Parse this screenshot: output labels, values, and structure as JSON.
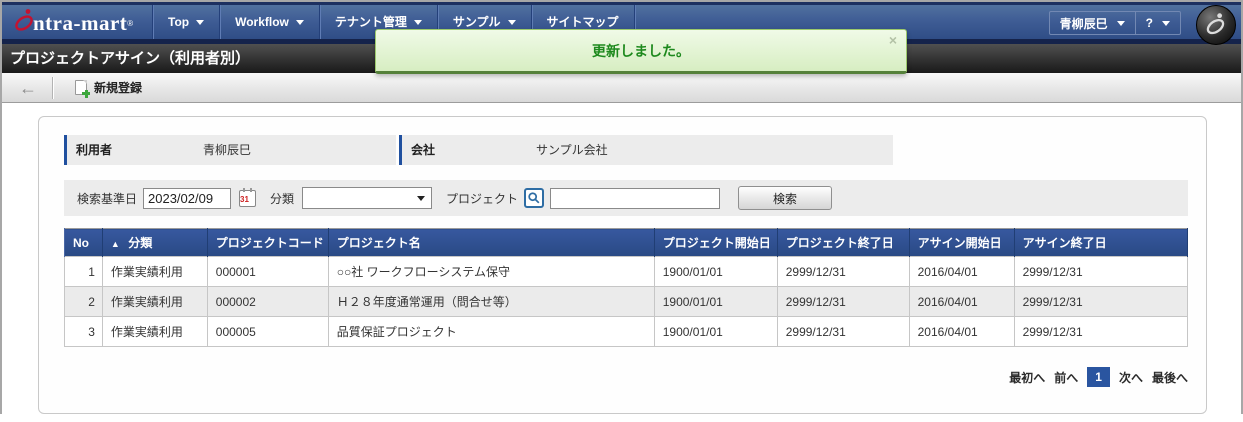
{
  "navbar": {
    "logo": {
      "text": "ntra-mart",
      "reg": "®"
    },
    "items": [
      {
        "label": "Top"
      },
      {
        "label": "Workflow"
      },
      {
        "label": "テナント管理"
      },
      {
        "label": "サンプル"
      },
      {
        "label": "サイトマップ"
      }
    ],
    "user_name": "青柳辰巳",
    "help_label": "?"
  },
  "icons": {
    "back": "←",
    "close": "×",
    "sort_asc": "▲"
  },
  "notification": {
    "message": "更新しました。"
  },
  "page_title": "プロジェクトアサイン（利用者別）",
  "toolbar": {
    "new_label": "新規登録"
  },
  "info": {
    "user_label": "利用者",
    "user_value": "青柳辰巳",
    "company_label": "会社",
    "company_value": "サンプル会社"
  },
  "search": {
    "base_date_label": "検索基準日",
    "base_date_value": "2023/02/09",
    "calendar_day": "31",
    "category_label": "分類",
    "category_value": "",
    "project_label": "プロジェクト",
    "project_value": "",
    "search_label": "検索"
  },
  "table": {
    "columns": [
      "No",
      "分類",
      "プロジェクトコード",
      "プロジェクト名",
      "プロジェクト開始日",
      "プロジェクト終了日",
      "アサイン開始日",
      "アサイン終了日"
    ],
    "rows": [
      {
        "no": "1",
        "category": "作業実績利用",
        "code": "000001",
        "name": "○○社 ワークフローシステム保守",
        "project_start": "1900/01/01",
        "project_end": "2999/12/31",
        "assign_start": "2016/04/01",
        "assign_end": "2999/12/31"
      },
      {
        "no": "2",
        "category": "作業実績利用",
        "code": "000002",
        "name": "Ｈ２８年度通常運用（問合せ等）",
        "project_start": "1900/01/01",
        "project_end": "2999/12/31",
        "assign_start": "2016/04/01",
        "assign_end": "2999/12/31"
      },
      {
        "no": "3",
        "category": "作業実績利用",
        "code": "000005",
        "name": "品質保証プロジェクト",
        "project_start": "1900/01/01",
        "project_end": "2999/12/31",
        "assign_start": "2016/04/01",
        "assign_end": "2999/12/31"
      }
    ]
  },
  "pagination": {
    "first": "最初へ",
    "prev": "前へ",
    "current": "1",
    "next": "次へ",
    "last": "最後へ"
  }
}
